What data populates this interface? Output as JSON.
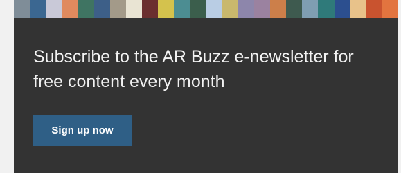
{
  "stripe": {
    "colors": [
      "#7f8d98",
      "#3b6791",
      "#c9c9d8",
      "#e08a5e",
      "#3f7462",
      "#3d5f88",
      "#a39a89",
      "#e9e4d3",
      "#6b2f2f",
      "#d4c24d",
      "#4c8d92",
      "#3b5e4c",
      "#b9cde4",
      "#c9b86d",
      "#8d86ab",
      "#9b82a0",
      "#cc7f4a",
      "#3e5a4f",
      "#7f9eb2",
      "#2f7a7a",
      "#2c4f8f",
      "#e8c28a",
      "#c9532f",
      "#e2743f"
    ]
  },
  "newsletter": {
    "headline": "Subscribe to the AR Buzz e-newsletter for free content every month",
    "button_label": "Sign up now"
  },
  "colors": {
    "card_background": "#333333",
    "page_background": "#f1f1f1",
    "button_background": "#2f5f86",
    "text": "#f2f2f2"
  }
}
